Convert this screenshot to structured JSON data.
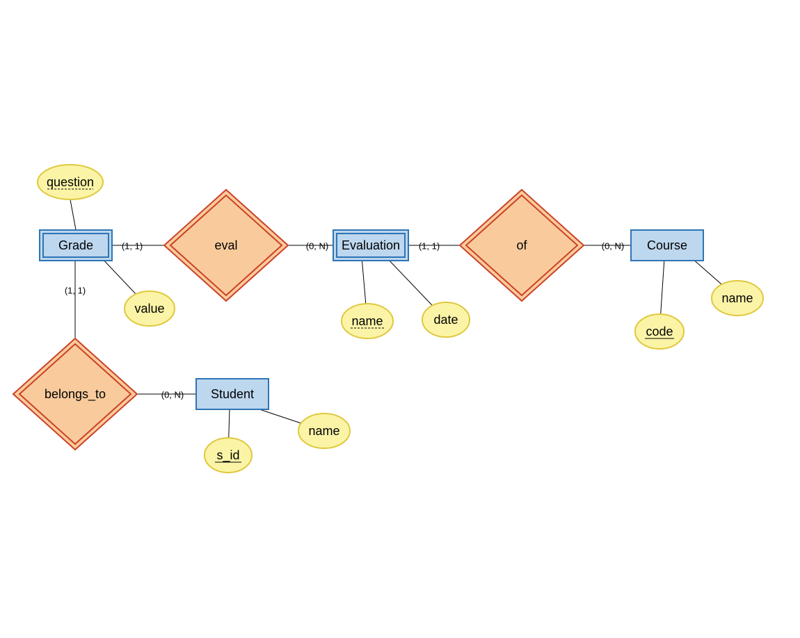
{
  "entities": {
    "grade": {
      "label": "Grade"
    },
    "evaluation": {
      "label": "Evaluation"
    },
    "course": {
      "label": "Course"
    },
    "student": {
      "label": "Student"
    }
  },
  "relationships": {
    "eval": {
      "label": "eval"
    },
    "of": {
      "label": "of"
    },
    "belongs_to": {
      "label": "belongs_to"
    }
  },
  "attributes": {
    "grade_question": {
      "label": "question",
      "key": true,
      "dashed": true
    },
    "grade_value": {
      "label": "value",
      "key": false
    },
    "evaluation_name": {
      "label": "name",
      "key": true,
      "dashed": true
    },
    "evaluation_date": {
      "label": "date",
      "key": false
    },
    "course_code": {
      "label": "code",
      "key": true
    },
    "course_name": {
      "label": "name",
      "key": false
    },
    "student_sid": {
      "label": "s_id",
      "key": true
    },
    "student_name": {
      "label": "name",
      "key": false
    }
  },
  "cardinalities": {
    "grade_eval": "(1, 1)",
    "eval_evaluation": "(0, N)",
    "evaluation_of": "(1, 1)",
    "of_course": "(0, N)",
    "grade_belongs": "(1, 1)",
    "belongs_student": "(0, N)"
  },
  "colors": {
    "entity_fill": "#bdd7ee",
    "entity_stroke": "#2e74b5",
    "relationship_fill": "#f9cb9c",
    "relationship_stroke": "#cc4125",
    "attribute_fill": "#fbf4a7",
    "attribute_stroke": "#e0c83d"
  }
}
